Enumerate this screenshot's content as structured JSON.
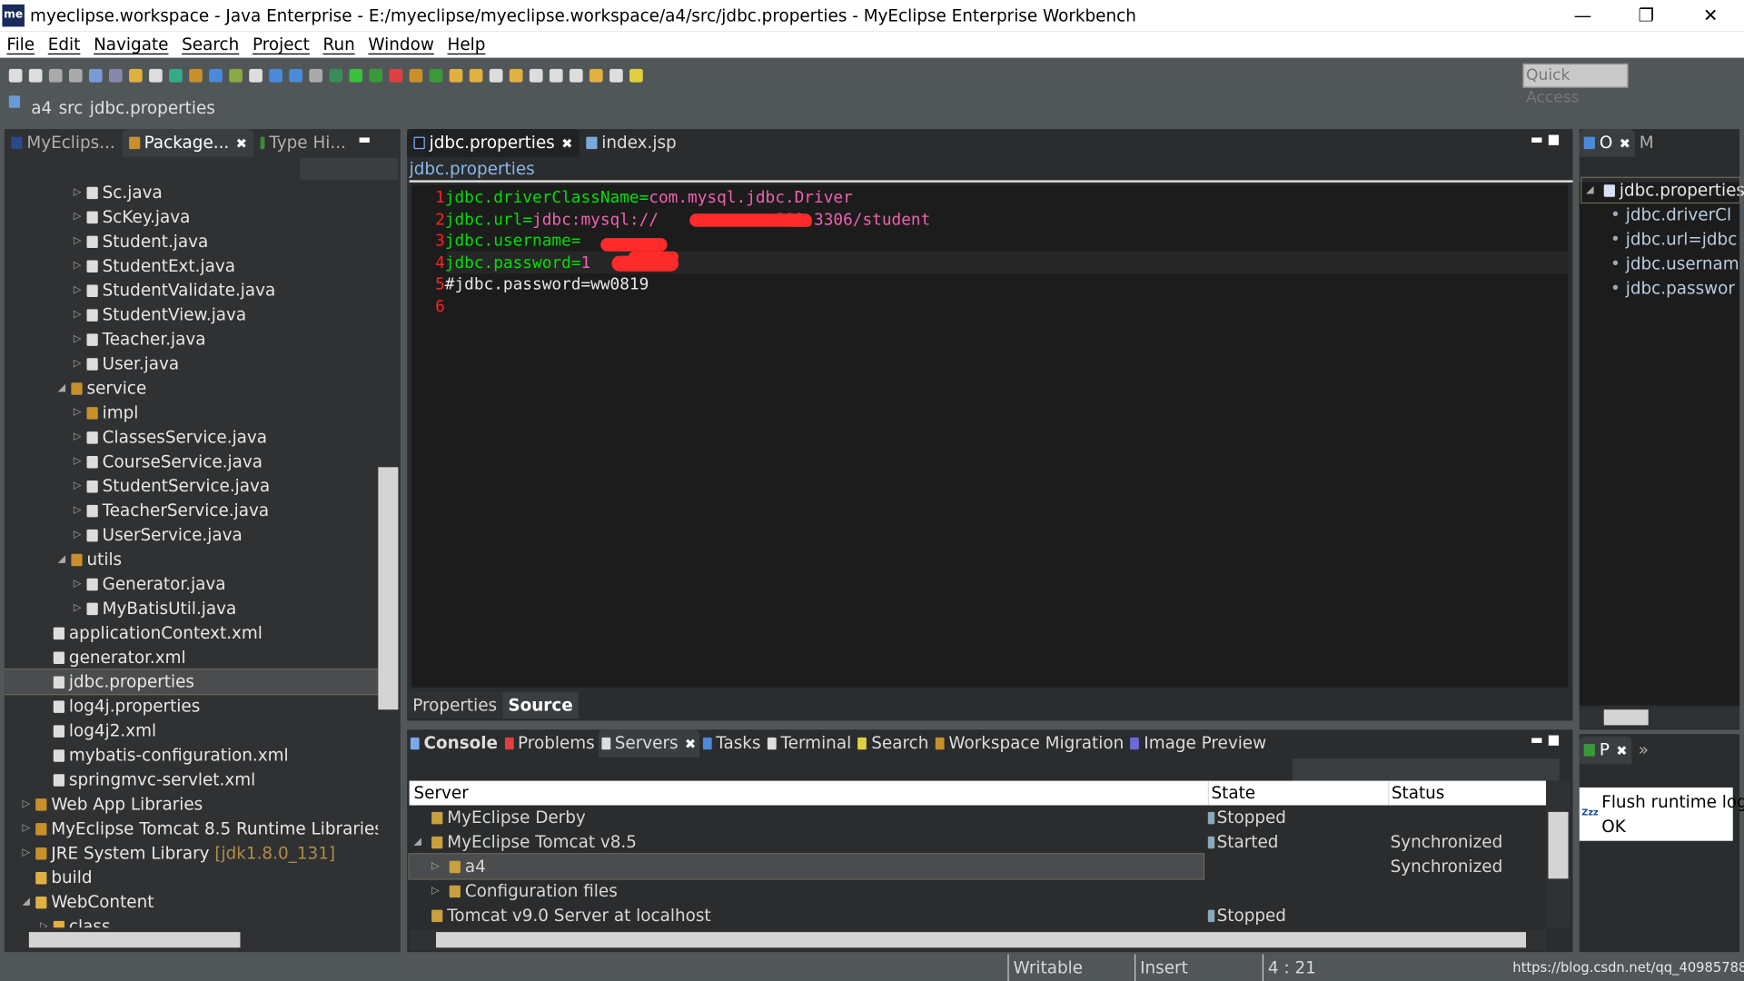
{
  "window": {
    "title": "myeclipse.workspace - Java Enterprise - E:/myeclipse/myeclipse.workspace/a4/src/jdbc.properties - MyEclipse Enterprise Workbench",
    "logo": "me",
    "minimize": "—",
    "restore": "❐",
    "close": "✕"
  },
  "menu": [
    "File",
    "Edit",
    "Navigate",
    "Search",
    "Project",
    "Run",
    "Window",
    "Help"
  ],
  "toolbar": {
    "quick_access": "Quick Access"
  },
  "breadcrumb": [
    "a4",
    "src",
    "jdbc.properties"
  ],
  "left_panel": {
    "tabs": [
      {
        "label": "MyEclips..."
      },
      {
        "label": "Package...",
        "active": true
      },
      {
        "label": "Type Hi..."
      }
    ],
    "tree": [
      {
        "label": "Sc.java",
        "level": 3,
        "arrow": "▷",
        "color": "#ddd"
      },
      {
        "label": "ScKey.java",
        "level": 3,
        "arrow": "▷",
        "color": "#ddd"
      },
      {
        "label": "Student.java",
        "level": 3,
        "arrow": "▷",
        "color": "#ddd"
      },
      {
        "label": "StudentExt.java",
        "level": 3,
        "arrow": "▷",
        "color": "#ddd"
      },
      {
        "label": "StudentValidate.java",
        "level": 3,
        "arrow": "▷",
        "color": "#ddd"
      },
      {
        "label": "StudentView.java",
        "level": 3,
        "arrow": "▷",
        "color": "#ddd"
      },
      {
        "label": "Teacher.java",
        "level": 3,
        "arrow": "▷",
        "color": "#ddd"
      },
      {
        "label": "User.java",
        "level": 3,
        "arrow": "▷",
        "color": "#ddd"
      },
      {
        "label": "service",
        "level": 2,
        "arrow": "◢",
        "color": "#c8902a"
      },
      {
        "label": "impl",
        "level": 3,
        "arrow": "▷",
        "color": "#c8902a"
      },
      {
        "label": "ClassesService.java",
        "level": 3,
        "arrow": "▷",
        "color": "#ddd"
      },
      {
        "label": "CourseService.java",
        "level": 3,
        "arrow": "▷",
        "color": "#ddd"
      },
      {
        "label": "StudentService.java",
        "level": 3,
        "arrow": "▷",
        "color": "#ddd"
      },
      {
        "label": "TeacherService.java",
        "level": 3,
        "arrow": "▷",
        "color": "#ddd"
      },
      {
        "label": "UserService.java",
        "level": 3,
        "arrow": "▷",
        "color": "#ddd"
      },
      {
        "label": "utils",
        "level": 2,
        "arrow": "◢",
        "color": "#c8902a"
      },
      {
        "label": "Generator.java",
        "level": 3,
        "arrow": "▷",
        "color": "#ddd"
      },
      {
        "label": "MyBatisUtil.java",
        "level": 3,
        "arrow": "▷",
        "color": "#ddd"
      },
      {
        "label": "applicationContext.xml",
        "level": 1,
        "arrow": "",
        "color": "#ddd"
      },
      {
        "label": "generator.xml",
        "level": 1,
        "arrow": "",
        "color": "#ddd"
      },
      {
        "label": "jdbc.properties",
        "level": 1,
        "arrow": "",
        "color": "#ddd",
        "selected": true
      },
      {
        "label": "log4j.properties",
        "level": 1,
        "arrow": "",
        "color": "#ddd"
      },
      {
        "label": "log4j2.xml",
        "level": 1,
        "arrow": "",
        "color": "#ddd"
      },
      {
        "label": "mybatis-configuration.xml",
        "level": 1,
        "arrow": "",
        "color": "#ddd"
      },
      {
        "label": "springmvc-servlet.xml",
        "level": 1,
        "arrow": "",
        "color": "#ddd"
      },
      {
        "label": "Web App Libraries",
        "level": 0,
        "arrow": "▷",
        "color": "#c8902a"
      },
      {
        "label": "MyEclipse Tomcat 8.5 Runtime Libraries",
        "level": 0,
        "arrow": "▷",
        "color": "#c8902a"
      },
      {
        "label": "JRE System Library",
        "suffix": "[jdk1.8.0_131]",
        "level": 0,
        "arrow": "▷",
        "color": "#c8902a"
      },
      {
        "label": "build",
        "level": 0,
        "arrow": "",
        "color": "#e0b040"
      },
      {
        "label": "WebContent",
        "level": 0,
        "arrow": "◢",
        "color": "#e0b040"
      },
      {
        "label": "class",
        "level": 1,
        "arrow": "▷",
        "color": "#e0b040"
      }
    ]
  },
  "editor": {
    "tabs": [
      {
        "label": "jdbc.properties",
        "active": true
      },
      {
        "label": "index.jsp"
      }
    ],
    "header": "jdbc.properties",
    "lines": [
      {
        "n": "1",
        "key": "jdbc.driverClassName=",
        "value": "com.mysql.jdbc.Driver"
      },
      {
        "n": "2",
        "key": "jdbc.url=",
        "value": "jdbc:mysql://            189:3306/student"
      },
      {
        "n": "3",
        "key": "jdbc.username=",
        "value": ""
      },
      {
        "n": "4",
        "key": "jdbc.password=",
        "value": "1"
      },
      {
        "n": "5",
        "comment": "#jdbc.password=ww0819"
      },
      {
        "n": "6"
      }
    ],
    "bottom_tabs": [
      {
        "label": "Properties"
      },
      {
        "label": "Source",
        "active": true
      }
    ],
    "redaction_color": "#ff2a2a"
  },
  "outline": {
    "tabs": [
      {
        "label": "O",
        "active": true
      },
      {
        "label": "M"
      }
    ],
    "root": "jdbc.properties",
    "items": [
      "jdbc.driverCl",
      "jdbc.url=jdbc",
      "jdbc.usernam",
      "jdbc.passwor"
    ]
  },
  "bottom": {
    "tabs": [
      {
        "label": "Console"
      },
      {
        "label": "Problems"
      },
      {
        "label": "Servers",
        "active": true
      },
      {
        "label": "Tasks"
      },
      {
        "label": "Terminal"
      },
      {
        "label": "Search"
      },
      {
        "label": "Workspace Migration"
      },
      {
        "label": "Image Preview"
      }
    ],
    "columns": [
      "Server",
      "State",
      "Status"
    ],
    "rows": [
      {
        "server": "MyEclipse Derby",
        "state": "Stopped",
        "status": "",
        "level": 0,
        "arrow": ""
      },
      {
        "server": "MyEclipse Tomcat v8.5",
        "state": "Started",
        "status": "Synchronized",
        "level": 0,
        "arrow": "◢"
      },
      {
        "server": "a4",
        "state": "",
        "status": "Synchronized",
        "level": 1,
        "arrow": "▷",
        "selected": true
      },
      {
        "server": "Configuration files",
        "state": "",
        "status": "",
        "level": 1,
        "arrow": "▷"
      },
      {
        "server": "Tomcat v9.0 Server at localhost",
        "state": "Stopped",
        "status": "",
        "level": 0,
        "arrow": ""
      }
    ]
  },
  "progress_panel": {
    "tab": "P",
    "more": "»",
    "message": "Flush runtime log",
    "result": "OK",
    "sleep_icon": "Zzz"
  },
  "status": {
    "writable": "Writable",
    "insert": "Insert",
    "position": "4 : 21",
    "watermark": "https://blog.csdn.net/qq_40985788"
  }
}
